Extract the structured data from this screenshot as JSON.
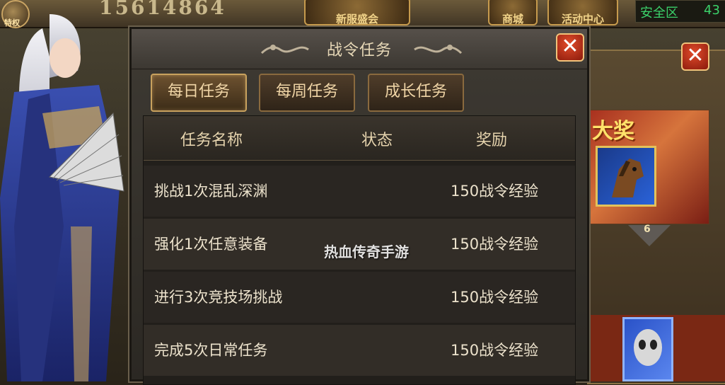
{
  "hud": {
    "power_value": "15614864",
    "badge_label": "特权",
    "btn_shop": "商城",
    "btn_activity": "活动中心",
    "btn_middle": "新服盛会",
    "safe_zone_label": "安全区",
    "safe_zone_value": "43"
  },
  "dialog": {
    "title": "战令任务",
    "close_symbol": "✕",
    "tabs": [
      {
        "label": "每日任务",
        "active": true
      },
      {
        "label": "每周任务",
        "active": false
      },
      {
        "label": "成长任务",
        "active": false
      }
    ],
    "columns": {
      "name": "任务名称",
      "status": "状态",
      "reward": "奖励"
    },
    "rows": [
      {
        "name": "挑战1次混乱深渊",
        "status": "",
        "reward": "150战令经验"
      },
      {
        "name": "强化1次任意装备",
        "status": "",
        "reward": "150战令经验"
      },
      {
        "name": "进行3次竞技场挑战",
        "status": "",
        "reward": "150战令经验"
      },
      {
        "name": "完成5次日常任务",
        "status": "",
        "reward": "150战令经验"
      }
    ]
  },
  "back_window": {
    "prize_title": "大奖",
    "level": "6",
    "close_symbol": "✕"
  },
  "watermark": "热血传奇手游",
  "colors": {
    "accent_gold": "#c9a25e",
    "close_red": "#e24c2b",
    "text_light": "#ece2cc",
    "safe_green": "#3bd16a"
  }
}
